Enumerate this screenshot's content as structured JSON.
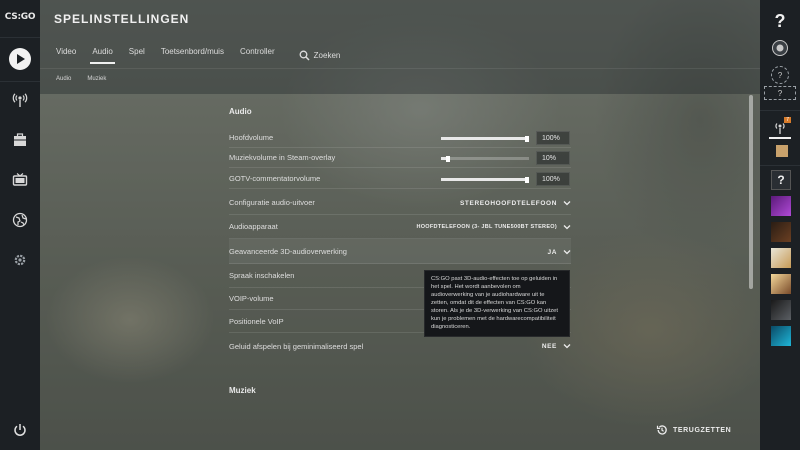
{
  "app": {
    "logo_text": "CS:GO"
  },
  "header": {
    "title": "SPELINSTELLINGEN",
    "tabs": [
      {
        "label": "Video"
      },
      {
        "label": "Audio"
      },
      {
        "label": "Spel"
      },
      {
        "label": "Toetsenbord/muis"
      },
      {
        "label": "Controller"
      }
    ],
    "search_label": "Zoeken",
    "subtabs": [
      {
        "label": "Audio"
      },
      {
        "label": "Muziek"
      }
    ]
  },
  "audio": {
    "section_title": "Audio",
    "sliders": [
      {
        "label": "Hoofdvolume",
        "value": "100%",
        "fraction": 1.0
      },
      {
        "label": "Muziekvolume in Steam-overlay",
        "value": "10%",
        "fraction": 0.1
      },
      {
        "label": "GOTV-commentatorvolume",
        "value": "100%",
        "fraction": 1.0
      }
    ],
    "dropdowns": [
      {
        "label": "Configuratie audio-uitvoer",
        "value": "STEREOHOOFDTELEFOON"
      },
      {
        "label": "Audioapparaat",
        "value": "HOOFDTELEFOON (3- JBL TUNE500BT STEREO)"
      },
      {
        "label": "Geavanceerde 3D-audioverwerking",
        "value": "JA"
      }
    ],
    "spraak_label": "Spraak inschakelen",
    "voip_volume_label": "VOIP-volume",
    "positionele_voip_label": "Positionele VoIP",
    "minimized_label": "Geluid afspelen bij geminimaliseerd spel",
    "minimized_value": "NEE"
  },
  "tooltip": {
    "text": "CS:GO past 3D-audio-effecten toe op geluiden in het spel. Het wordt aanbevolen om audioverwerking van je audiohardware uit te zetten, omdat dit de effecten van CS:GO kan storen. Als je de 3D-verwerking van CS:GO uitzet kun je problemen met de hardwarecompatibiliteit diagnosticeren."
  },
  "music": {
    "section_title": "Muziek"
  },
  "footer": {
    "reset_label": "TERUGZETTEN"
  },
  "right_sidebar": {
    "help_glyph": "?",
    "rank_badge": "?",
    "invite_glyph": "?",
    "notification_count": "7"
  },
  "colors": {
    "sidebar_bg": "#1c2024",
    "accent_white": "#f0f0f0"
  }
}
